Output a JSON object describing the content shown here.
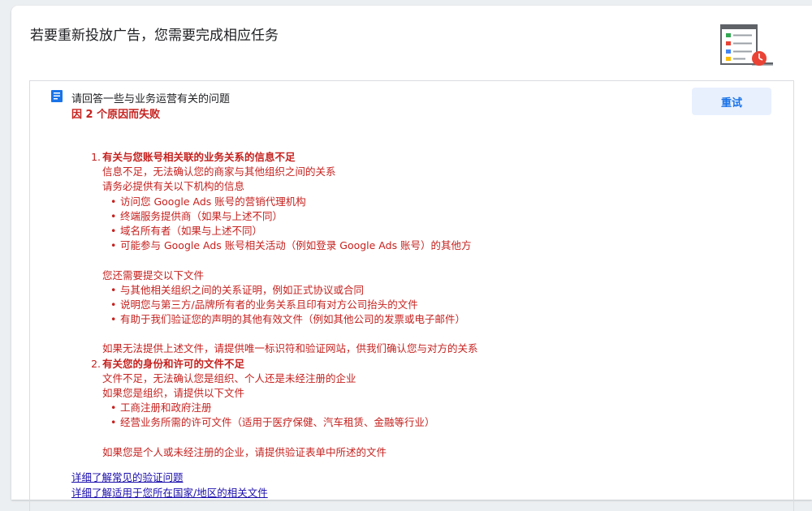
{
  "page": {
    "title": "若要重新投放广告，您需要完成相应任务"
  },
  "icons": {
    "task": "document-icon",
    "illustration": "checklist-clock-illustration"
  },
  "colors": {
    "error": "#c5221f",
    "link": "#1a0dab",
    "button_bg": "#e8f0fe",
    "button_text": "#1a73e8"
  },
  "task": {
    "title": "请回答一些与业务运营有关的问题",
    "status": "因 2 个原因而失败",
    "retry_label": "重试"
  },
  "reasons": [
    {
      "number": "1.",
      "heading": "有关与您账号相关联的业务关系的信息不足",
      "desc1": "信息不足，无法确认您的商家与其他组织之间的关系",
      "desc2": "请务必提供有关以下机构的信息",
      "bullets1": [
        "访问您 Google Ads 账号的营销代理机构",
        "终端服务提供商（如果与上述不同）",
        "域名所有者（如果与上述不同）",
        "可能参与 Google Ads 账号相关活动（例如登录 Google Ads 账号）的其他方"
      ],
      "desc3": "您还需要提交以下文件",
      "bullets2": [
        "与其他相关组织之间的关系证明，例如正式协议或合同",
        "说明您与第三方/品牌所有者的业务关系且印有对方公司抬头的文件",
        "有助于我们验证您的声明的其他有效文件（例如其他公司的发票或电子邮件）"
      ],
      "desc4": "如果无法提供上述文件，请提供唯一标识符和验证网站，供我们确认您与对方的关系"
    },
    {
      "number": "2.",
      "heading": "有关您的身份和许可的文件不足",
      "desc1": "文件不足，无法确认您是组织、个人还是未经注册的企业",
      "desc2": "如果您是组织，请提供以下文件",
      "bullets1": [
        "工商注册和政府注册",
        "经营业务所需的许可文件（适用于医疗保健、汽车租赁、金融等行业）"
      ],
      "desc3": "如果您是个人或未经注册的企业，请提供验证表单中所述的文件"
    }
  ],
  "links": [
    "详细了解常见的验证问题",
    "详细了解适用于您所在国家/地区的相关文件"
  ]
}
